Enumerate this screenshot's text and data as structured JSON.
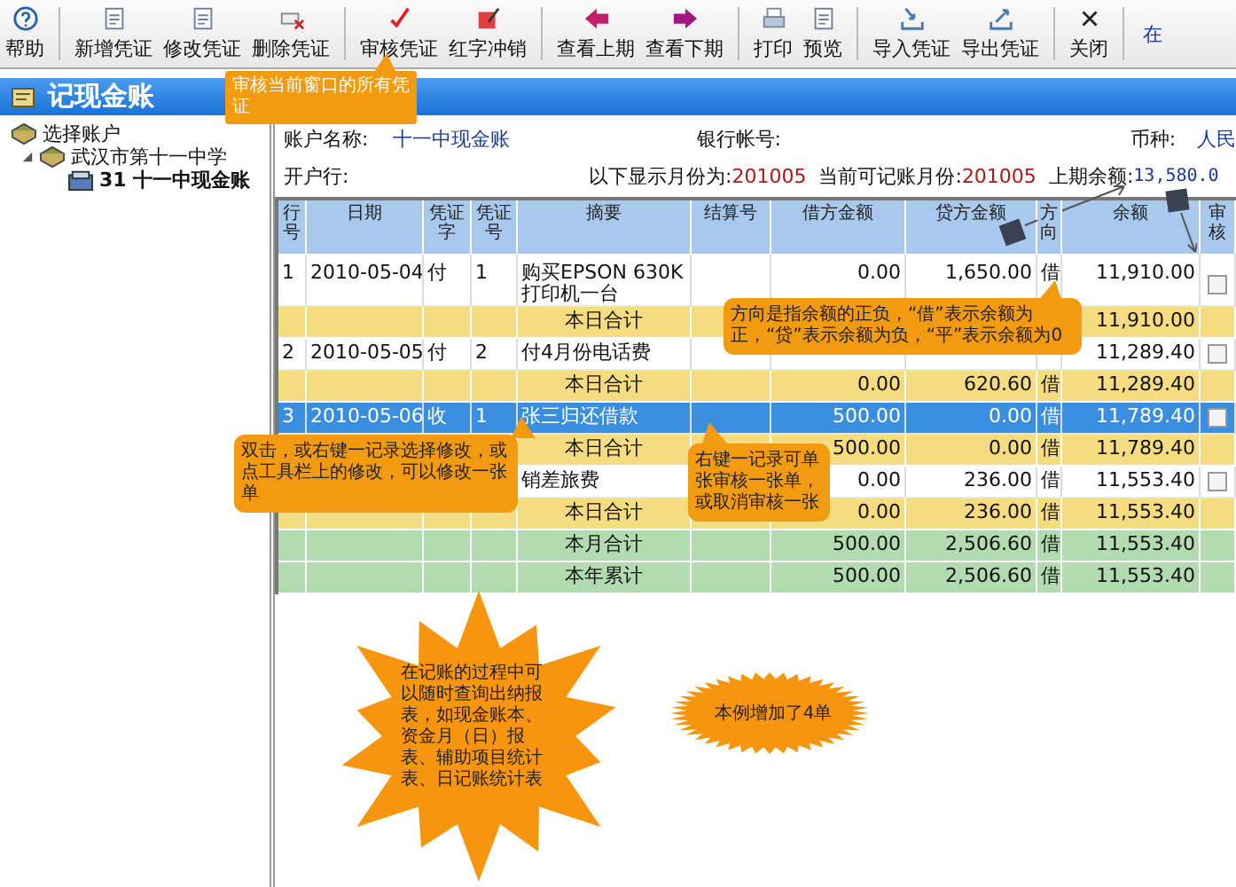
{
  "toolbar": [
    {
      "label": "帮助"
    },
    {
      "label": "新增凭证"
    },
    {
      "label": "修改凭证"
    },
    {
      "label": "删除凭证"
    },
    {
      "label": "审核凭证"
    },
    {
      "label": "红字冲销"
    },
    {
      "label": "查看上期"
    },
    {
      "label": "查看下期"
    },
    {
      "label": "打印"
    },
    {
      "label": "预览"
    },
    {
      "label": "导入凭证"
    },
    {
      "label": "导出凭证"
    },
    {
      "label": "关闭"
    },
    {
      "label": "在"
    }
  ],
  "panel_title": "记现金账",
  "tree": [
    {
      "label": "选择账户",
      "children": [
        {
          "label": "武汉市第十一中学",
          "expanded": true,
          "children": [
            {
              "label": "31  十一中现金账",
              "selected": true
            }
          ]
        }
      ]
    }
  ],
  "account": {
    "name_label": "账户名称:",
    "name": "十一中现金账",
    "bank_label": "银行帐号:",
    "currency_label": "币种:",
    "currency": "人民",
    "opening_bank_label": "开户行:",
    "display_month_label": "以下显示月份为:",
    "display_month": "201005",
    "current_month_label": "当前可记账月份:",
    "current_month": "201005",
    "prior_balance_label": "上期余额:",
    "prior_balance": "13,580.0"
  },
  "table": {
    "columns": [
      "行号",
      "日期",
      "凭证字",
      "凭证号",
      "摘要",
      "结算号",
      "借方金额",
      "贷方金额",
      "方向",
      "余额",
      "审核"
    ],
    "rows": [
      {
        "kind": "entry",
        "selected": false,
        "audited": false,
        "row_no": "1",
        "date": "2010-05-04",
        "voucher_type": "付",
        "voucher_no": "1",
        "summary": "购买EPSON 630K打印机一台",
        "debit": "0.00",
        "credit": "1,650.00",
        "direction": "借",
        "balance": "11,910.00"
      },
      {
        "kind": "day_total",
        "summary": "本日合计",
        "balance": "11,910.00"
      },
      {
        "kind": "entry",
        "selected": false,
        "audited": false,
        "row_no": "2",
        "date": "2010-05-05",
        "voucher_type": "付",
        "voucher_no": "2",
        "summary": "付4月份电话费",
        "balance": "11,289.40"
      },
      {
        "kind": "day_total",
        "summary": "本日合计",
        "debit": "0.00",
        "credit": "620.60",
        "direction": "借",
        "balance": "11,289.40"
      },
      {
        "kind": "entry",
        "selected": true,
        "audited": false,
        "row_no": "3",
        "date": "2010-05-06",
        "voucher_type": "收",
        "voucher_no": "1",
        "summary": "张三归还借款",
        "debit": "500.00",
        "credit": "0.00",
        "direction": "借",
        "balance": "11,789.40"
      },
      {
        "kind": "day_total",
        "summary": "本日合计",
        "debit": "500.00",
        "credit": "0.00",
        "direction": "借",
        "balance": "11,789.40"
      },
      {
        "kind": "entry",
        "selected": false,
        "audited": false,
        "summary": "销差旅费",
        "debit": "0.00",
        "credit": "236.00",
        "direction": "借",
        "balance": "11,553.40"
      },
      {
        "kind": "day_total",
        "summary": "本日合计",
        "debit": "0.00",
        "credit": "236.00",
        "direction": "借",
        "balance": "11,553.40"
      },
      {
        "kind": "month_total",
        "summary": "本月合计",
        "debit": "500.00",
        "credit": "2,506.60",
        "direction": "借",
        "balance": "11,553.40"
      },
      {
        "kind": "year_total",
        "summary": "本年累计",
        "debit": "500.00",
        "credit": "2,506.60",
        "direction": "借",
        "balance": "11,553.40"
      }
    ]
  },
  "callouts": [
    {
      "kind": "tooltip",
      "text": "审核当前窗口的所有凭证"
    },
    {
      "kind": "bubble",
      "text": "方向是指余额的正负，“借”表示余额为正，“贷”表示余额为负，“平”表示余额为0"
    },
    {
      "kind": "bubble",
      "text": "双击，或右键一记录选择修改，或点工具栏上的修改，可以修改一张单"
    },
    {
      "kind": "bubble",
      "text": "右键一记录可单张审核一张单，或取消审核一张"
    },
    {
      "kind": "burst",
      "text": "在记账的过程中可以随时查询出纳报表，如现金账本、资金月（日）报表、辅助项目统计表、日记账统计表"
    },
    {
      "kind": "oval_burst",
      "text": "本例增加了4单"
    }
  ]
}
